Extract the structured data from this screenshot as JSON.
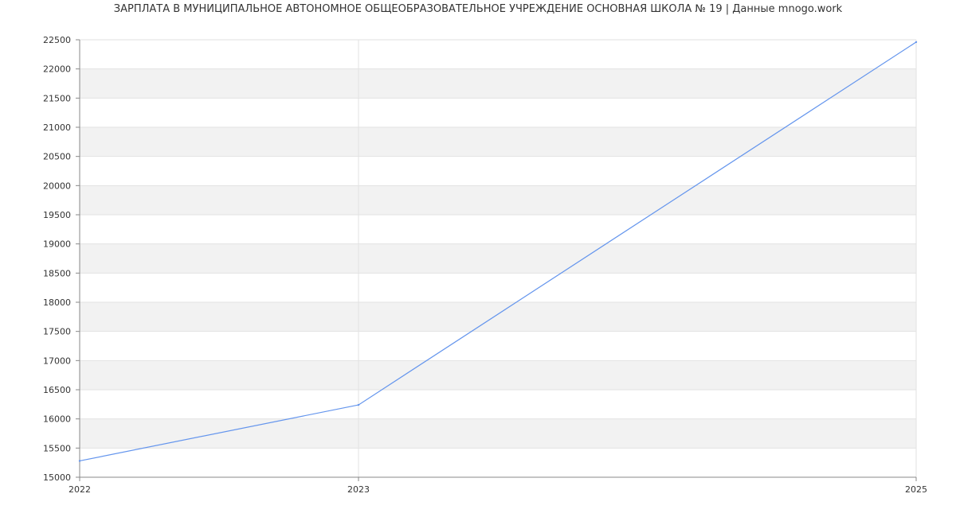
{
  "chart_data": {
    "type": "line",
    "title": "ЗАРПЛАТА В МУНИЦИПАЛЬНОЕ АВТОНОМНОЕ ОБЩЕОБРАЗОВАТЕЛЬНОЕ УЧРЕЖДЕНИЕ ОСНОВНАЯ ШКОЛА № 19 | Данные mnogo.work",
    "xlabel": "",
    "ylabel": "",
    "x_ticks": [
      "2022",
      "2023",
      "2025"
    ],
    "y_ticks": [
      15000,
      15500,
      16000,
      16500,
      17000,
      17500,
      18000,
      18500,
      19000,
      19500,
      20000,
      20500,
      21000,
      21500,
      22000,
      22500
    ],
    "ylim": [
      15000,
      22500
    ],
    "grid": true,
    "series": [
      {
        "x": [
          "2022",
          "2023",
          "2025"
        ],
        "values": [
          15280,
          16240,
          22460
        ],
        "color": "#6495ed"
      }
    ]
  }
}
